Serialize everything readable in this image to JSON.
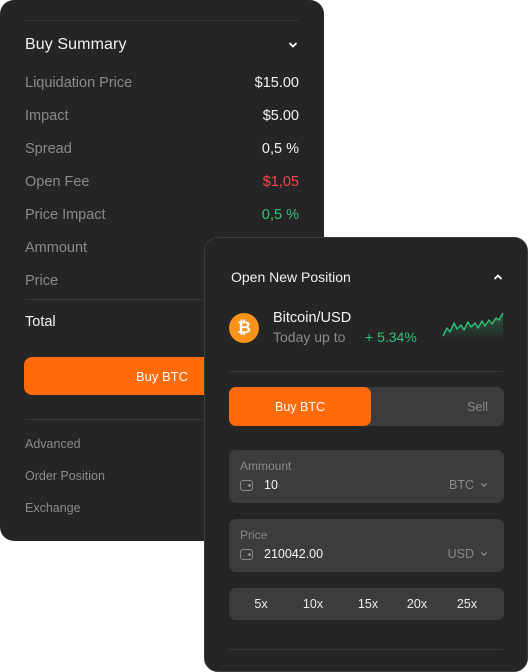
{
  "buy_summary": {
    "title": "Buy Summary",
    "rows": [
      {
        "label": "Liquidation Price",
        "value": "$15.00"
      },
      {
        "label": "Impact",
        "value": "$5.00"
      },
      {
        "label": "Spread",
        "value": "0,5 %"
      },
      {
        "label": "Open Fee",
        "value": "$1,05"
      },
      {
        "label": "Price Impact",
        "value": "0,5 %"
      },
      {
        "label": "Ammount",
        "value": ""
      },
      {
        "label": "Price",
        "value": ""
      }
    ],
    "total_label": "Total",
    "buy_button": "Buy BTC",
    "links": [
      "Advanced",
      "Order Position",
      "Exchange"
    ]
  },
  "open_position": {
    "title": "Open New Position",
    "asset": {
      "name": "Bitcoin/USD",
      "subtitle": "Today up to",
      "change": "+ 5.34%",
      "icon": "bitcoin-icon"
    },
    "toggle": {
      "buy": "Buy BTC",
      "sell": "Sell",
      "selected": "buy"
    },
    "amount": {
      "label": "Ammount",
      "value": "10",
      "unit": "BTC"
    },
    "price": {
      "label": "Price",
      "value": "210042.00",
      "unit": "USD"
    },
    "leverage": [
      "5x",
      "10x",
      "15x",
      "20x",
      "25x"
    ]
  },
  "colors": {
    "accent": "#ff6a0a",
    "positive": "#2fc27a",
    "negative": "#f0494e",
    "card_bg": "#252525",
    "field_bg": "#3c3c3c"
  }
}
